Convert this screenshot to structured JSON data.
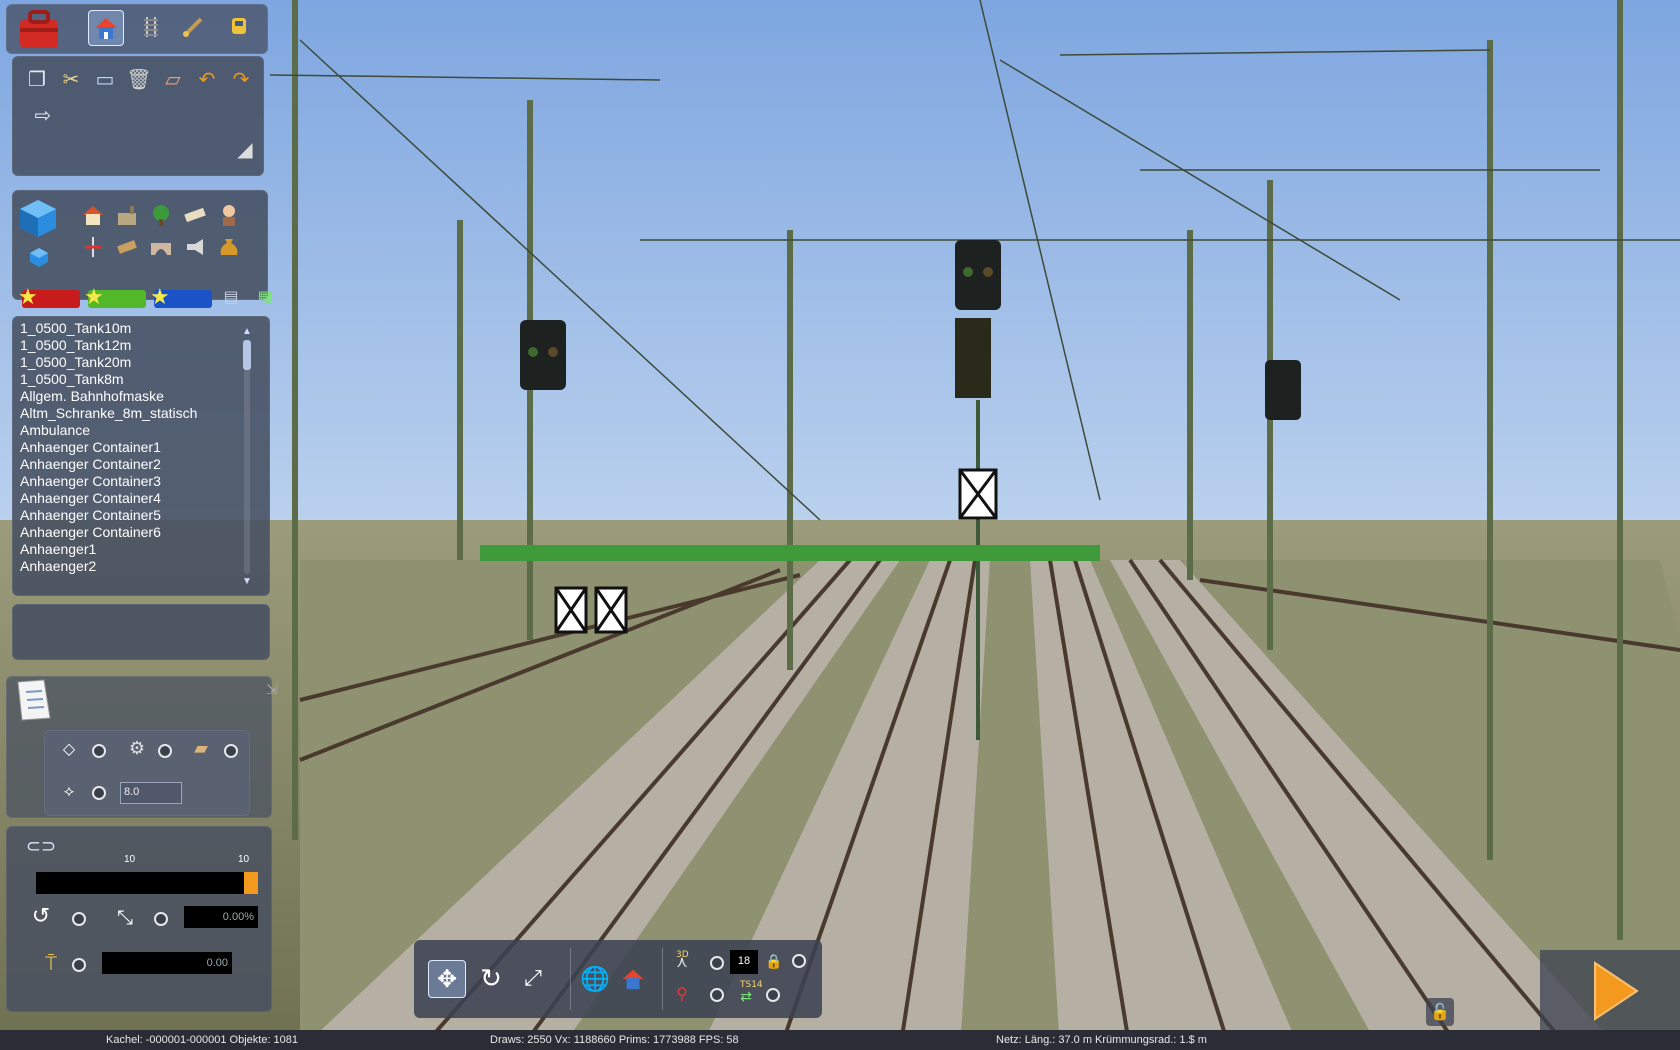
{
  "toolbar_top": {
    "items": [
      {
        "name": "toolbox-icon"
      },
      {
        "name": "home-icon",
        "active": true
      },
      {
        "name": "track-icon"
      },
      {
        "name": "paint-brush-icon"
      },
      {
        "name": "train-icon"
      }
    ]
  },
  "edit_tools": [
    "copy-icon",
    "cut-icon",
    "monitor-icon",
    "trash-icon",
    "eraser-icon",
    "undo-icon",
    "redo-icon",
    "sign-icon"
  ],
  "category_icons_row1": [
    "house-icon",
    "factory-icon",
    "tree-icon",
    "ruler-icon",
    "person-icon"
  ],
  "category_icons_row2": [
    "signal-icon",
    "plank-icon",
    "bridge-icon",
    "horn-icon",
    "sack-icon"
  ],
  "favorites": [
    "favorite-red",
    "favorite-green",
    "favorite-blue"
  ],
  "object_list": {
    "items": [
      "1_0500_Tank10m",
      "1_0500_Tank12m",
      "1_0500_Tank20m",
      "1_0500_Tank8m",
      "Allgem. Bahnhofmaske",
      "Altm_Schranke_8m_statisch",
      "Ambulance",
      "Anhaenger Container1",
      "Anhaenger Container2",
      "Anhaenger Container3",
      "Anhaenger Container4",
      "Anhaenger Container5",
      "Anhaenger Container6",
      "Anhaenger1",
      "Anhaenger2"
    ]
  },
  "placement": {
    "offset_value": "8.0"
  },
  "transform": {
    "slider_min_label": "10",
    "slider_max_label": "10",
    "rotation_value": "0.00%",
    "height_value": "0.00"
  },
  "bottom_toolbar": {
    "counter_value": "18",
    "label_3d": "3D",
    "label_ts14": "TS14"
  },
  "status_bar": {
    "tile": "Kachel: -000001-000001  Objekte: 1081",
    "stats": "Draws: 2550 Vx: 1188660 Prims: 1773988 FPS: 58",
    "net": "Netz:  Läng.:  37.0 m  Krümmungsrad.:  1.$ m"
  },
  "colors": {
    "panel": "#464e60",
    "accent_orange": "#f39a1e",
    "sky": "#8fb6e6"
  }
}
